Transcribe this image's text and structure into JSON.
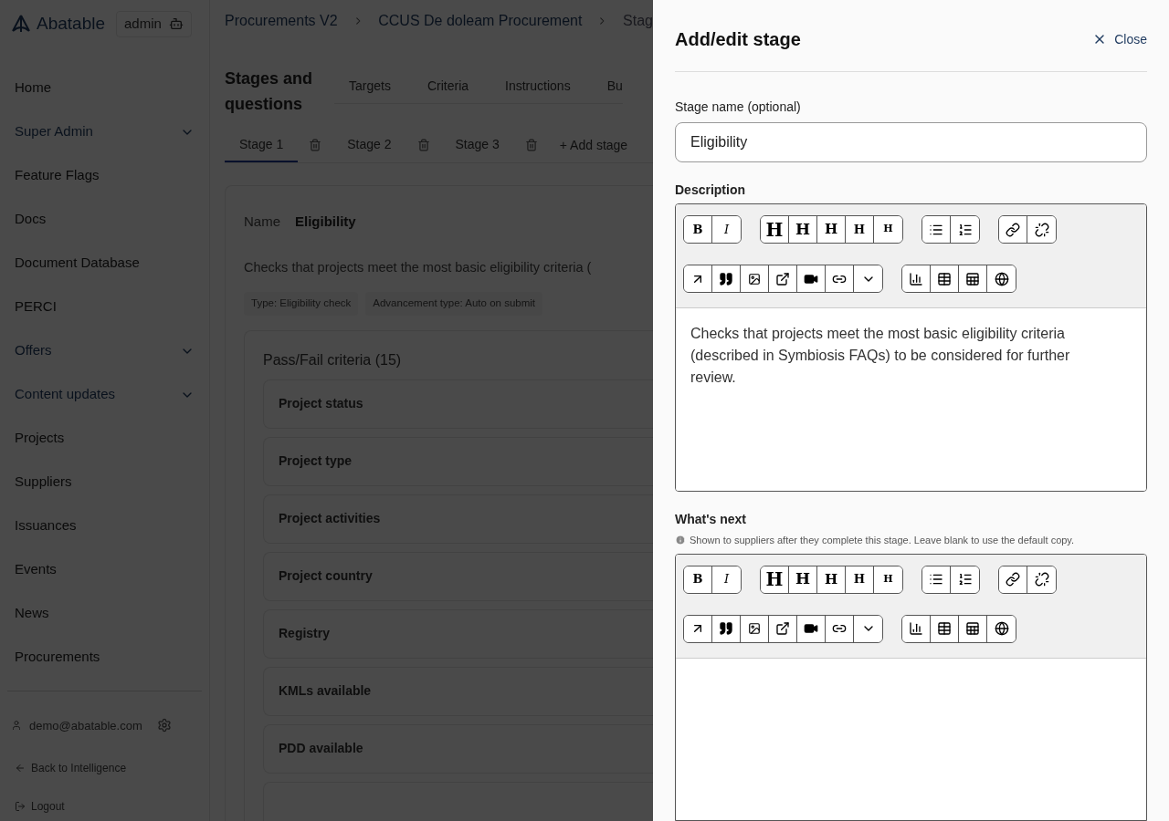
{
  "brand": {
    "name": "Abatable",
    "badge": "admin"
  },
  "sidebar": {
    "items": [
      {
        "label": "Home",
        "kind": "link"
      },
      {
        "label": "Super Admin",
        "kind": "group",
        "expanded": false
      },
      {
        "label": "Feature Flags",
        "kind": "link"
      },
      {
        "label": "Docs",
        "kind": "link"
      },
      {
        "label": "Document Database",
        "kind": "link"
      },
      {
        "label": "PERCI",
        "kind": "link"
      },
      {
        "label": "Offers",
        "kind": "group",
        "expanded": false
      },
      {
        "label": "Content updates",
        "kind": "group",
        "expanded": false
      },
      {
        "label": "Projects",
        "kind": "link"
      },
      {
        "label": "Suppliers",
        "kind": "link"
      },
      {
        "label": "Issuances",
        "kind": "link"
      },
      {
        "label": "Events",
        "kind": "link"
      },
      {
        "label": "News",
        "kind": "link"
      },
      {
        "label": "Procurements",
        "kind": "link"
      }
    ],
    "user": "demo@abatable.com",
    "back": "Back to Intelligence",
    "logout": "Logout"
  },
  "breadcrumbs": [
    "Procurements V2",
    "CCUS De doleam Procurement",
    "Stag"
  ],
  "page": {
    "title": "Stages and questions",
    "tabs": [
      {
        "label": "Targets",
        "selected": false
      },
      {
        "label": "Criteria",
        "selected": false
      },
      {
        "label": "Instructions",
        "selected": false
      },
      {
        "label": "Bu",
        "selected": false
      }
    ],
    "stages": [
      {
        "label": "Stage 1",
        "selected": true
      },
      {
        "label": "Stage 2",
        "selected": false
      },
      {
        "label": "Stage 3",
        "selected": false
      }
    ],
    "add_stage": "+ Add stage",
    "name_label": "Name",
    "name_value": "Eligibility",
    "description": "Checks that projects meet the most basic eligibility criteria (",
    "tags": [
      "Type: Eligibility check",
      "Advancement type: Auto on submit"
    ],
    "criteria_title": "Pass/Fail criteria (15)",
    "criteria": [
      "Project status",
      "Project type",
      "Project activities",
      "Project country",
      "Registry",
      "KMLs available",
      "PDD available"
    ]
  },
  "panel": {
    "title": "Add/edit stage",
    "close": "Close",
    "stage_name_label": "Stage name (optional)",
    "stage_name_value": "Eligibility",
    "description_label": "Description",
    "description_toolbar": [
      "B",
      "I",
      "H",
      "H",
      "H",
      "H",
      "H"
    ],
    "description_text": "Checks that projects meet the most basic eligibility criteria (described in Symbiosis FAQs) to be considered for further review.",
    "next_label": "What's next",
    "next_hint": "Shown to suppliers after they complete this stage. Leave blank to use the default copy.",
    "next_toolbar": [
      "B",
      "I",
      "H",
      "H",
      "H",
      "H",
      "H"
    ]
  }
}
